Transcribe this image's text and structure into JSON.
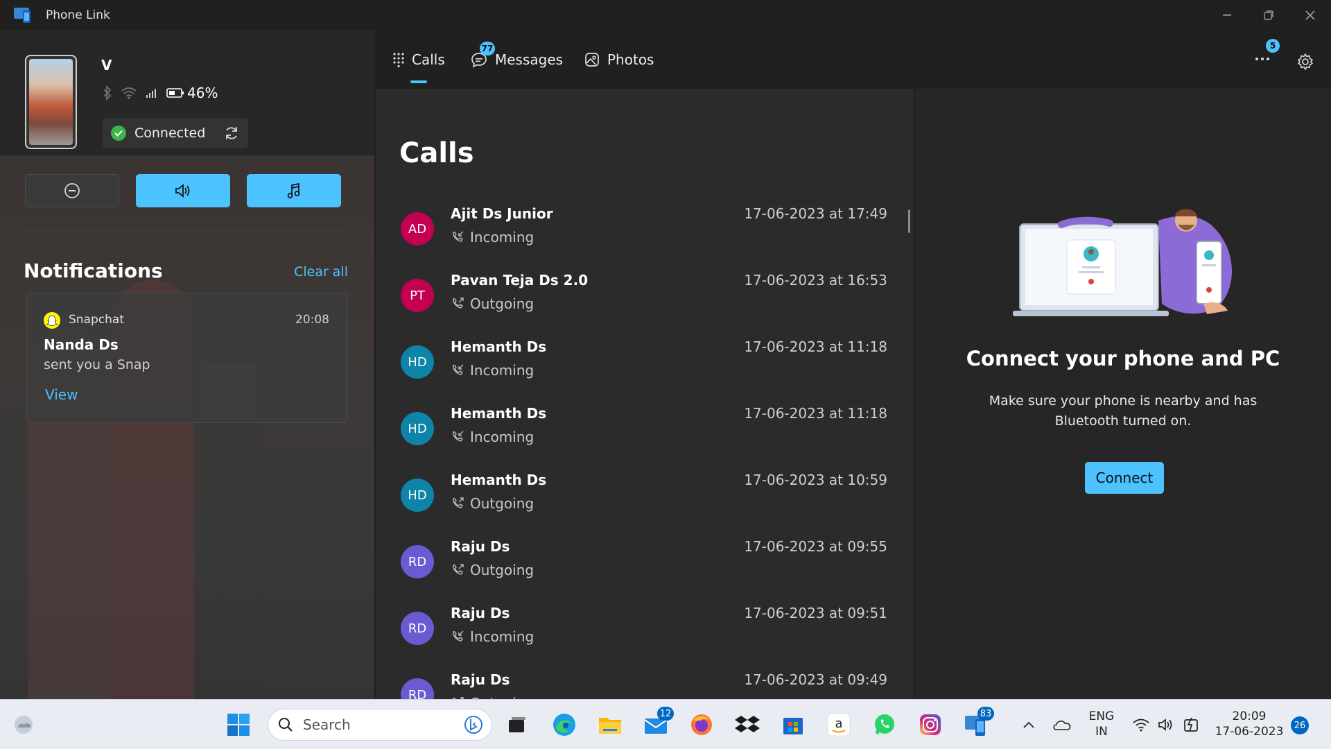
{
  "window": {
    "title": "Phone Link"
  },
  "device": {
    "name": "V",
    "battery": "46%",
    "status": "Connected"
  },
  "notifications": {
    "title": "Notifications",
    "clear_all": "Clear all",
    "items": [
      {
        "app": "Snapchat",
        "time": "20:08",
        "sender": "Nanda Ds",
        "message": "sent you a Snap",
        "action": "View"
      }
    ]
  },
  "tabs": [
    {
      "label": "Calls",
      "icon": "dialpad-icon",
      "selected": true
    },
    {
      "label": "Messages",
      "icon": "chat-icon",
      "badge": "77"
    },
    {
      "label": "Photos",
      "icon": "photos-icon"
    }
  ],
  "header": {
    "more_badge": "5"
  },
  "calls": {
    "title": "Calls",
    "rows": [
      {
        "initials": "AD",
        "name": "Ajit Ds Junior",
        "type": "Incoming",
        "date": "17-06-2023 at 17:49",
        "color": "#c30052"
      },
      {
        "initials": "PT",
        "name": "Pavan Teja Ds 2.0",
        "type": "Outgoing",
        "date": "17-06-2023 at 16:53",
        "color": "#c30052"
      },
      {
        "initials": "HD",
        "name": "Hemanth Ds",
        "type": "Incoming",
        "date": "17-06-2023 at 11:18",
        "color": "#0e84a8"
      },
      {
        "initials": "HD",
        "name": "Hemanth Ds",
        "type": "Incoming",
        "date": "17-06-2023 at 11:18",
        "color": "#0e84a8"
      },
      {
        "initials": "HD",
        "name": "Hemanth Ds",
        "type": "Outgoing",
        "date": "17-06-2023 at 10:59",
        "color": "#0e84a8"
      },
      {
        "initials": "RD",
        "name": "Raju Ds",
        "type": "Outgoing",
        "date": "17-06-2023 at 09:55",
        "color": "#6b5bd2"
      },
      {
        "initials": "RD",
        "name": "Raju Ds",
        "type": "Incoming",
        "date": "17-06-2023 at 09:51",
        "color": "#6b5bd2"
      },
      {
        "initials": "RD",
        "name": "Raju Ds",
        "type": "Outgoing",
        "date": "17-06-2023 at 09:49",
        "color": "#6b5bd2"
      }
    ]
  },
  "connect_panel": {
    "title": "Connect your phone and PC",
    "text": "Make sure your phone is nearby and has Bluetooth turned on.",
    "button": "Connect"
  },
  "taskbar": {
    "search_placeholder": "Search",
    "mail_badge": "12",
    "phonelink_badge": "83",
    "language": "ENG",
    "region": "IN",
    "time": "20:09",
    "date": "17-06-2023",
    "notification_count": "26"
  },
  "colors": {
    "accent": "#4cc2ff",
    "background": "#202020",
    "panel": "#2b2b2b"
  }
}
